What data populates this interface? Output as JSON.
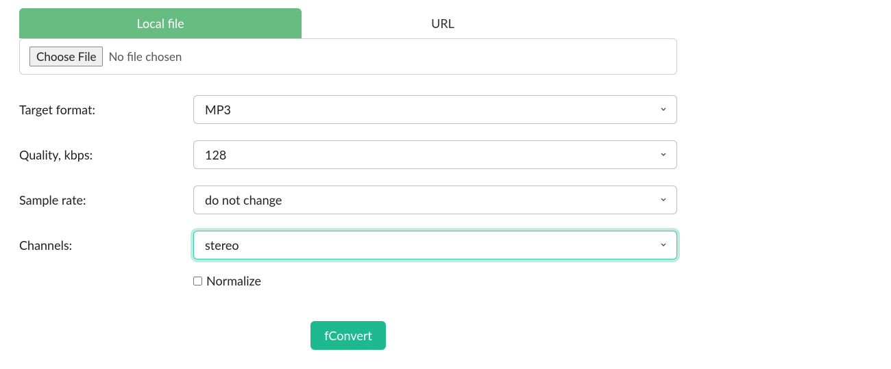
{
  "tabs": {
    "local_file": "Local file",
    "url": "URL"
  },
  "file_input": {
    "button_label": "Choose File",
    "status_text": "No file chosen"
  },
  "fields": {
    "target_format": {
      "label": "Target format:",
      "value": "MP3"
    },
    "quality": {
      "label": "Quality, kbps:",
      "value": "128"
    },
    "sample_rate": {
      "label": "Sample rate:",
      "value": "do not change"
    },
    "channels": {
      "label": "Channels:",
      "value": "stereo"
    },
    "normalize": {
      "label": "Normalize",
      "checked": false
    }
  },
  "submit_label": "fConvert",
  "colors": {
    "tab_active_bg": "#67bc81",
    "focus_ring": "#3fc7a6",
    "submit_bg": "#1fb990"
  }
}
